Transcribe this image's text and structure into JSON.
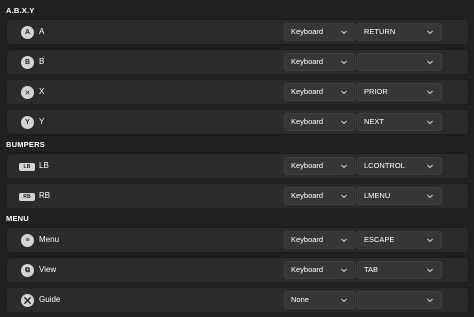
{
  "sections": [
    {
      "title": "A.B.X.Y",
      "rows": [
        {
          "icon": "a-button-icon",
          "glyph": "A",
          "label": "A",
          "type": "Keyboard",
          "key": "RETURN"
        },
        {
          "icon": "b-button-icon",
          "glyph": "B",
          "label": "B",
          "type": "Keyboard",
          "key": ""
        },
        {
          "icon": "x-button-icon",
          "glyph": "✕",
          "label": "X",
          "type": "Keyboard",
          "key": "PRIOR"
        },
        {
          "icon": "y-button-icon",
          "glyph": "Y",
          "label": "Y",
          "type": "Keyboard",
          "key": "NEXT"
        }
      ]
    },
    {
      "title": "BUMPERS",
      "rows": [
        {
          "icon": "lb-bumper-icon",
          "glyph": "LB",
          "label": "LB",
          "type": "Keyboard",
          "key": "LCONTROL"
        },
        {
          "icon": "rb-bumper-icon",
          "glyph": "RB",
          "label": "RB",
          "type": "Keyboard",
          "key": "LMENU"
        }
      ]
    },
    {
      "title": "MENU",
      "rows": [
        {
          "icon": "menu-button-icon",
          "glyph": "≡",
          "label": "Menu",
          "type": "Keyboard",
          "key": "ESCAPE"
        },
        {
          "icon": "view-button-icon",
          "glyph": "⧉",
          "label": "View",
          "type": "Keyboard",
          "key": "TAB"
        },
        {
          "icon": "xbox-guide-icon",
          "glyph": "",
          "label": "Guide",
          "type": "None",
          "key": ""
        }
      ]
    }
  ]
}
